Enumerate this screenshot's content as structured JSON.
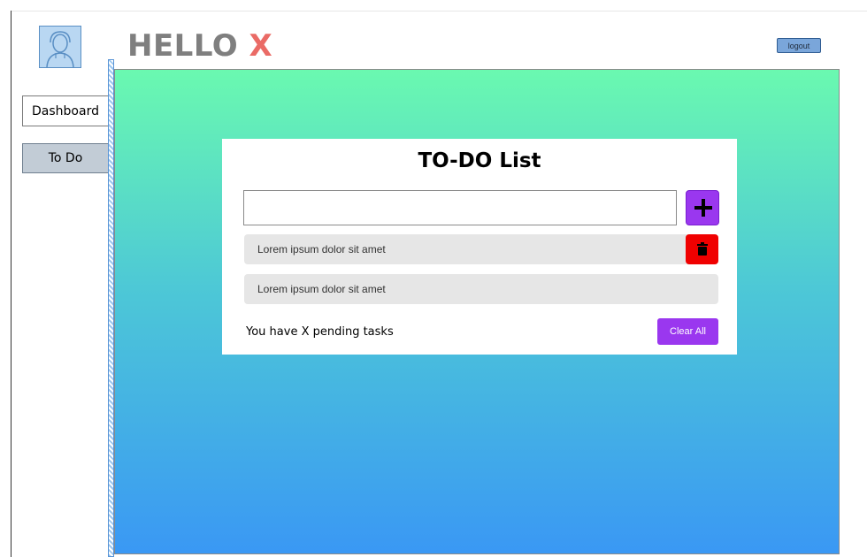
{
  "header": {
    "greeting": "HELLO",
    "user_name": "X",
    "logout_label": "logout",
    "avatar_icon": "user-avatar-icon"
  },
  "sidebar": {
    "items": [
      {
        "label": "Dashboard",
        "active": false
      },
      {
        "label": "To Do",
        "active": true
      }
    ]
  },
  "todo": {
    "title": "TO-DO List",
    "input": {
      "value": "",
      "placeholder": ""
    },
    "add_icon": "plus-icon",
    "delete_icon": "trash-icon",
    "tasks": [
      {
        "text": "Lorem ipsum dolor sit amet",
        "show_delete": true
      },
      {
        "text": "Lorem ipsum dolor sit amet",
        "show_delete": false
      }
    ],
    "pending_text": "You have X pending tasks",
    "clear_all_label": "Clear All"
  },
  "colors": {
    "accent_purple": "#9a37ef",
    "delete_red": "#f00000",
    "name_highlight": "#ea6b66",
    "gradient_top": "#6af9b0",
    "gradient_bottom": "#3a98f4"
  }
}
